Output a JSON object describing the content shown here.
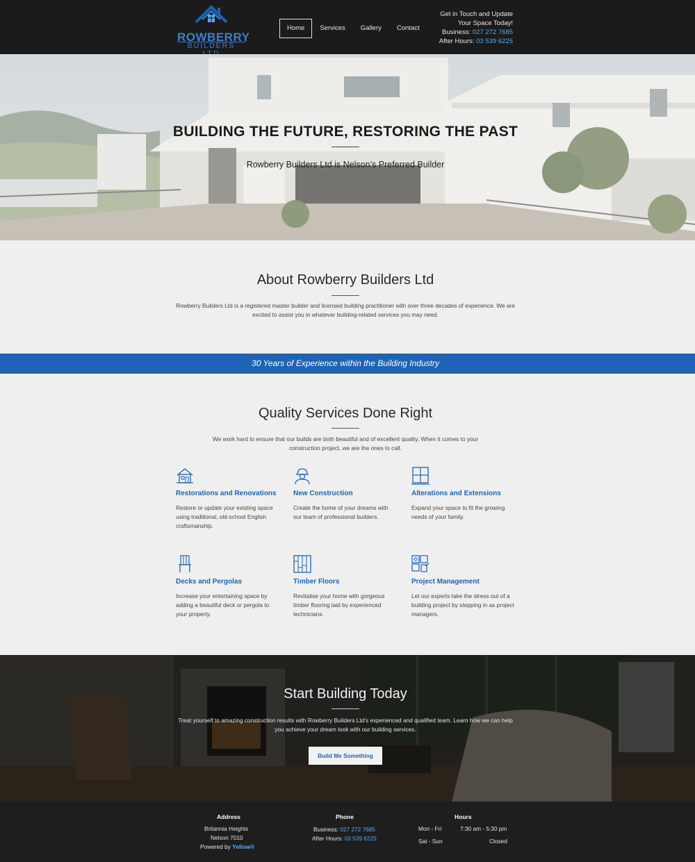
{
  "brand": {
    "name": "ROWBERRY",
    "sub": "BUILDERS LTD"
  },
  "nav": [
    {
      "label": "Home"
    },
    {
      "label": "Services"
    },
    {
      "label": "Gallery"
    },
    {
      "label": "Contact"
    }
  ],
  "contact": {
    "line1": "Get in Touch and Update",
    "line2": "Your Space Today!",
    "business_label": "Business:",
    "business_phone": "027 272 7685",
    "after_label": "After Hours:",
    "after_phone": "03 539 6225"
  },
  "hero": {
    "title": "BUILDING THE FUTURE, RESTORING THE PAST",
    "subtitle": "Rowberry Builders Ltd is Nelson’s Preferred Builder"
  },
  "about": {
    "title": "About Rowberry Builders Ltd",
    "text": "Rowberry Builders Ltd is a registered master builder and licensed building practitioner with over three decades of experience. We are excited to assist you in whatever building-related services you may need."
  },
  "band": {
    "text": "30 Years of Experience within the Building Industry"
  },
  "services": {
    "title": "Quality Services Done Right",
    "intro": "We work hard to ensure that our builds are both beautiful and of excellent quality. When it comes to your construction project, we are the ones to call.",
    "items": [
      {
        "title": "Restorations and Renovations",
        "desc": "Restore or update your existing space using traditional, old-school English craftsmanship.",
        "icon": "house-icon"
      },
      {
        "title": "New Construction",
        "desc": "Create the home of your dreams with our team of professional builders.",
        "icon": "builder-icon"
      },
      {
        "title": "Alterations and Extensions",
        "desc": "Expand your space to fit the growing needs of your family.",
        "icon": "window-icon"
      },
      {
        "title": "Decks and Pergolas",
        "desc": "Increase your entertaining space by adding a beautiful deck or pergola to your property.",
        "icon": "deck-chair-icon"
      },
      {
        "title": "Timber Floors",
        "desc": "Revitalise your home with gorgeous timber flooring laid by experienced technicians.",
        "icon": "floorboards-icon"
      },
      {
        "title": "Project Management",
        "desc": "Let our experts take the stress out of a building project by stepping in as project managers.",
        "icon": "blueprint-icon"
      }
    ]
  },
  "cta": {
    "title": "Start Building Today",
    "text": "Treat yourself to amazing construction results with Rowberry Builders Ltd’s experienced and qualified team. Learn how we can help you achieve your dream look with our building services.",
    "button": "Build Me Something"
  },
  "footer": {
    "address_head": "Address",
    "address1": "Britannia Heights",
    "address2": "Nelson 7010",
    "powered_label": "Powered by",
    "powered_link": "Yellow®",
    "phone_head": "Phone",
    "business_label": "Business:",
    "business_phone": "027 272 7685",
    "after_label": "After Hours:",
    "after_phone": "03 539 6225",
    "hours_head": "Hours",
    "weekday_label": "Mon - Fri",
    "weekday_hours": "7:30 am - 5:30 pm",
    "weekend_label": "Sat - Sun",
    "weekend_hours": "Closed"
  },
  "colors": {
    "accent": "#1d64b4",
    "link": "#5ea9f0",
    "header_bg": "#1b1b1b",
    "page_bg": "#efefef"
  }
}
